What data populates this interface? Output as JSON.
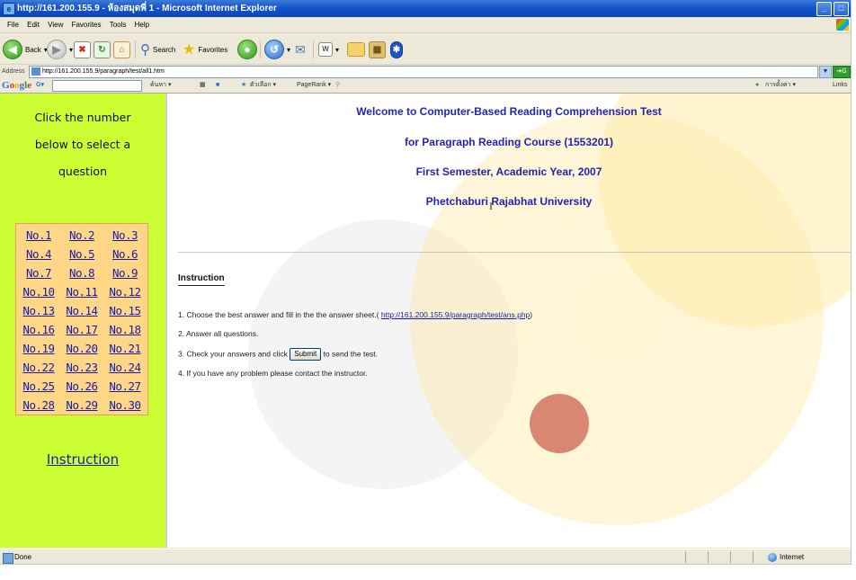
{
  "window": {
    "title": "http://161.200.155.9 - ห้องสมุดพี่ 1 - Microsoft Internet Explorer",
    "controls": [
      "_",
      "□"
    ]
  },
  "menu": [
    "File",
    "Edit",
    "View",
    "Favorites",
    "Tools",
    "Help"
  ],
  "toolbar": {
    "back_label": "Back",
    "search_label": "Search",
    "favorites_label": "Favorites"
  },
  "address": {
    "label": "Address",
    "url": "http://161.200.155.9/paragraph/test/all1.htm",
    "go_label": "G"
  },
  "google_bar": {
    "logo": "Google",
    "g_label": "G▾",
    "items": [
      "ค้นหา ▾",
      "ตัวเลือก ▾",
      "PageRank ▾"
    ],
    "right_items": [
      "การตั้งค่า ▾",
      "Links"
    ]
  },
  "sidebar": {
    "title_lines": [
      "Click the number",
      "below to select a",
      "question"
    ],
    "questions": [
      [
        "No.1",
        "No.2",
        "No.3"
      ],
      [
        "No.4",
        "No.5",
        "No.6"
      ],
      [
        "No.7",
        "No.8",
        "No.9"
      ],
      [
        "No.10",
        "No.11",
        "No.12"
      ],
      [
        "No.13",
        "No.14",
        "No.15"
      ],
      [
        "No.16",
        "No.17",
        "No.18"
      ],
      [
        "No.19",
        "No.20",
        "No.21"
      ],
      [
        "No.22",
        "No.23",
        "No.24"
      ],
      [
        "No.25",
        "No.26",
        "No.27"
      ],
      [
        "No.28",
        "No.29",
        "No.30"
      ]
    ],
    "instruction_link": "Instruction"
  },
  "main": {
    "headings": [
      "Welcome to Computer-Based Reading Comprehension Test",
      "for Paragraph Reading Course (1553201)",
      "First Semester,  Academic Year, 2007",
      "Phetchaburi Rajabhat University"
    ],
    "instruction_title": "Instruction",
    "step1_text": "1. Choose the best answer and fill in the the answer sheet.(",
    "step1_link": "http://161.200.155.9/paragraph/test/ans.php",
    "step1_end": ")",
    "step2_text": "2. Answer all questions.",
    "step3_before": "3. Check your answers and click",
    "submit_label": "Submit",
    "step3_after": "to send the test.",
    "step4_text": "4. If you have any problem please contact the instructor."
  },
  "status": {
    "text": "Done",
    "zone": "Internet"
  }
}
